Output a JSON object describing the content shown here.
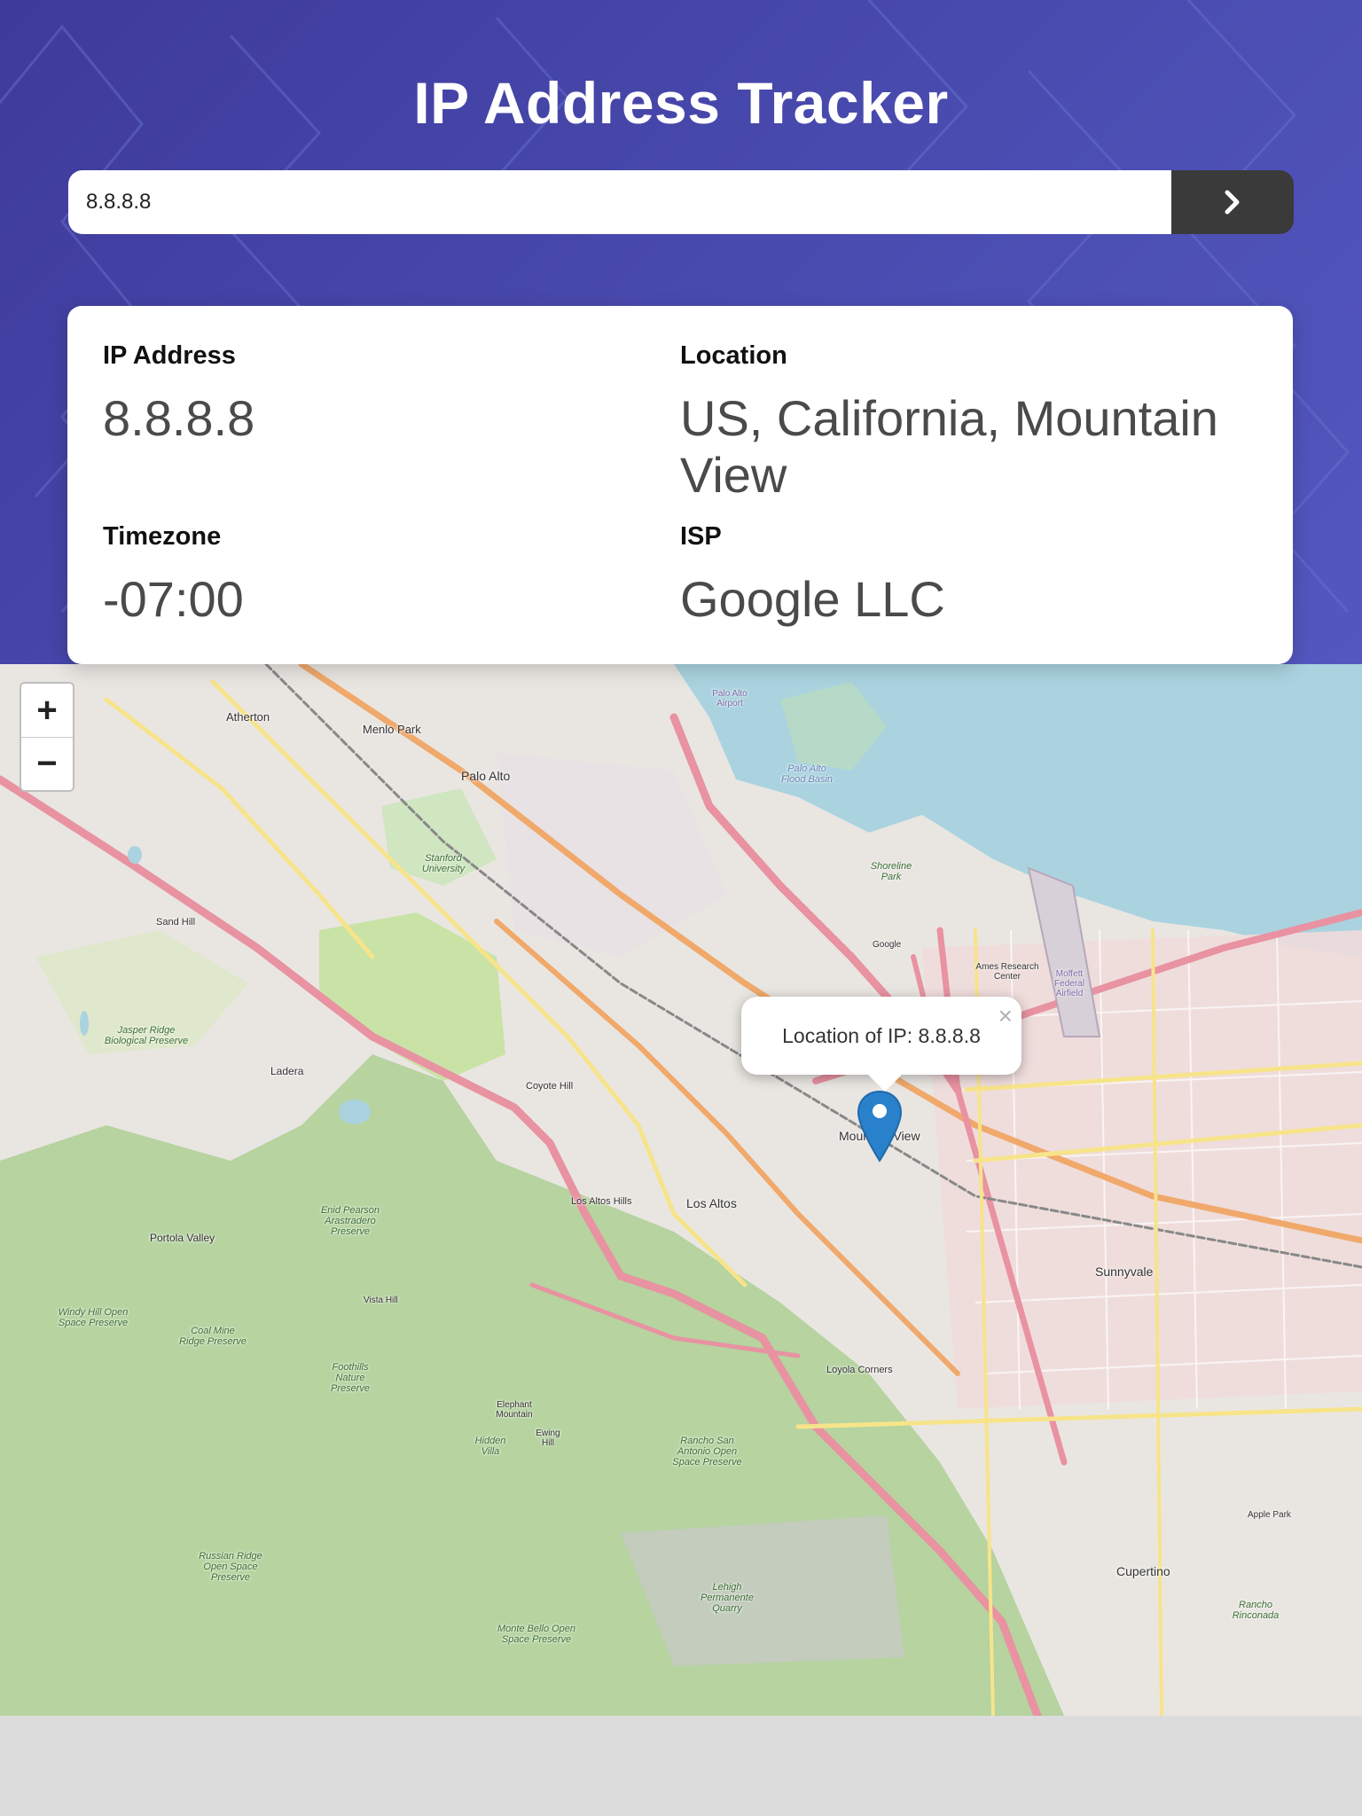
{
  "header": {
    "title": "IP Address Tracker",
    "search": {
      "value": "8.8.8.8",
      "button_icon": "chevron-right-icon"
    },
    "colors": {
      "gradient_start": "#3e3a9b",
      "gradient_end": "#5357bf",
      "button": "#3a3a3a"
    }
  },
  "info": {
    "ip": {
      "label": "IP Address",
      "value": "8.8.8.8"
    },
    "location": {
      "label": "Location",
      "value": "US, California, Mountain View"
    },
    "timezone": {
      "label": "Timezone",
      "value": "-07:00"
    },
    "isp": {
      "label": "ISP",
      "value": "Google LLC"
    }
  },
  "map": {
    "zoom_in": "+",
    "zoom_out": "−",
    "popup": {
      "text": "Location of IP: 8.8.8.8",
      "close": "×"
    },
    "marker_icon": "map-pin-icon",
    "places": [
      "Atherton",
      "Menlo Park",
      "Palo Alto",
      "Stanford University",
      "Sand Hill",
      "Jasper Ridge Biological Preserve",
      "Ladera",
      "Coyote Hill",
      "Shoreline Park",
      "Ames Research Center",
      "Moffett Federal Airfield",
      "Mountain View",
      "Los Altos Hills",
      "Los Altos",
      "Portola Valley",
      "Enid Pearson Arastradero Preserve",
      "Windy Hill Open Space Preserve",
      "Coal Mine Ridge Preserve",
      "Vista Hill",
      "Foothills Nature Preserve",
      "Elephant Mountain",
      "Hidden Villa",
      "Ewing Hill",
      "Rancho San Antonio Open Space Preserve",
      "Sunnyvale",
      "Loyola Corners",
      "Cupertino",
      "Lehigh Permanente Quarry",
      "Monte Bello Open Space Preserve",
      "Russian Ridge Open Space Preserve",
      "Rancho Rinconada",
      "Apple Park",
      "Palo Alto Airport",
      "Palo Alto Flood Basin",
      "Google"
    ]
  }
}
